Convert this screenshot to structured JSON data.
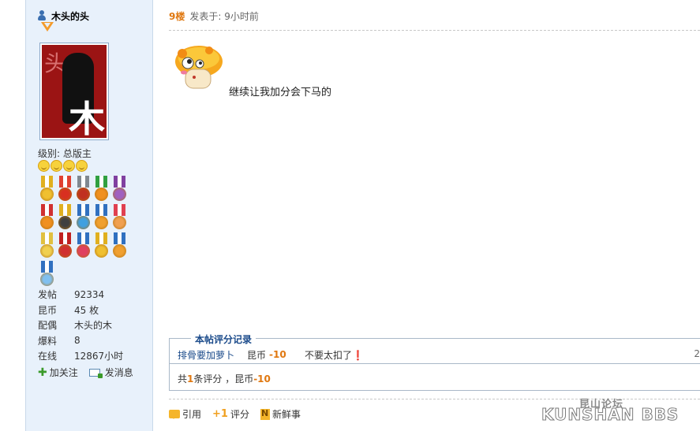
{
  "author": {
    "name": "木头的头",
    "level_label": "级别: 总版主",
    "avatar_text_top": "头",
    "avatar_text_bottom": "木",
    "stats": [
      {
        "key": "发帖",
        "value": "92334"
      },
      {
        "key": "昆币",
        "value": "45 枚"
      },
      {
        "key": "配偶",
        "value": "木头的木"
      },
      {
        "key": "爆料",
        "value": "8"
      },
      {
        "key": "在线",
        "value": "12867小时"
      }
    ],
    "actions": {
      "follow": "加关注",
      "message": "发消息"
    },
    "medal_colors": [
      [
        "#e0b020",
        "#f0c030"
      ],
      [
        "#e04030",
        "#d83020"
      ],
      [
        "#808890",
        "#c03020"
      ],
      [
        "#30a040",
        "#f09020"
      ],
      [
        "#8040a0",
        "#a060c0"
      ],
      [
        "#d03030",
        "#f09020"
      ],
      [
        "#e0b020",
        "#404040"
      ],
      [
        "#3070c0",
        "#40a0e0"
      ],
      [
        "#3070c0",
        "#f0a030"
      ],
      [
        "#e04050",
        "#f0a050"
      ],
      [
        "#e0c040",
        "#f0d050"
      ],
      [
        "#c02020",
        "#d03030"
      ],
      [
        "#3070c0",
        "#e04060"
      ],
      [
        "#e0b020",
        "#f0c030"
      ],
      [
        "#3070c0",
        "#f0a030"
      ],
      [
        "#3070c0",
        "#80c0f0"
      ]
    ]
  },
  "post": {
    "floor": "9楼",
    "posted_time": "发表于: 9小时前",
    "content": "继续让我加分会下马的"
  },
  "rating": {
    "title": "本帖评分记录",
    "rows": [
      {
        "user": "排骨要加萝卜",
        "kind": "昆币",
        "value": "-10",
        "reason": "不要太扣了❗",
        "num": "2"
      }
    ],
    "summary_prefix": "共",
    "summary_count": "1",
    "summary_mid": "条评分 ，昆币",
    "summary_value": "-10"
  },
  "post_actions": {
    "quote": "引用",
    "rate_prefix": "+1",
    "rate": "评分",
    "news": "新鲜事"
  },
  "watermark": {
    "top": "昆山论坛",
    "bottom": "KUNSHAN BBS"
  }
}
